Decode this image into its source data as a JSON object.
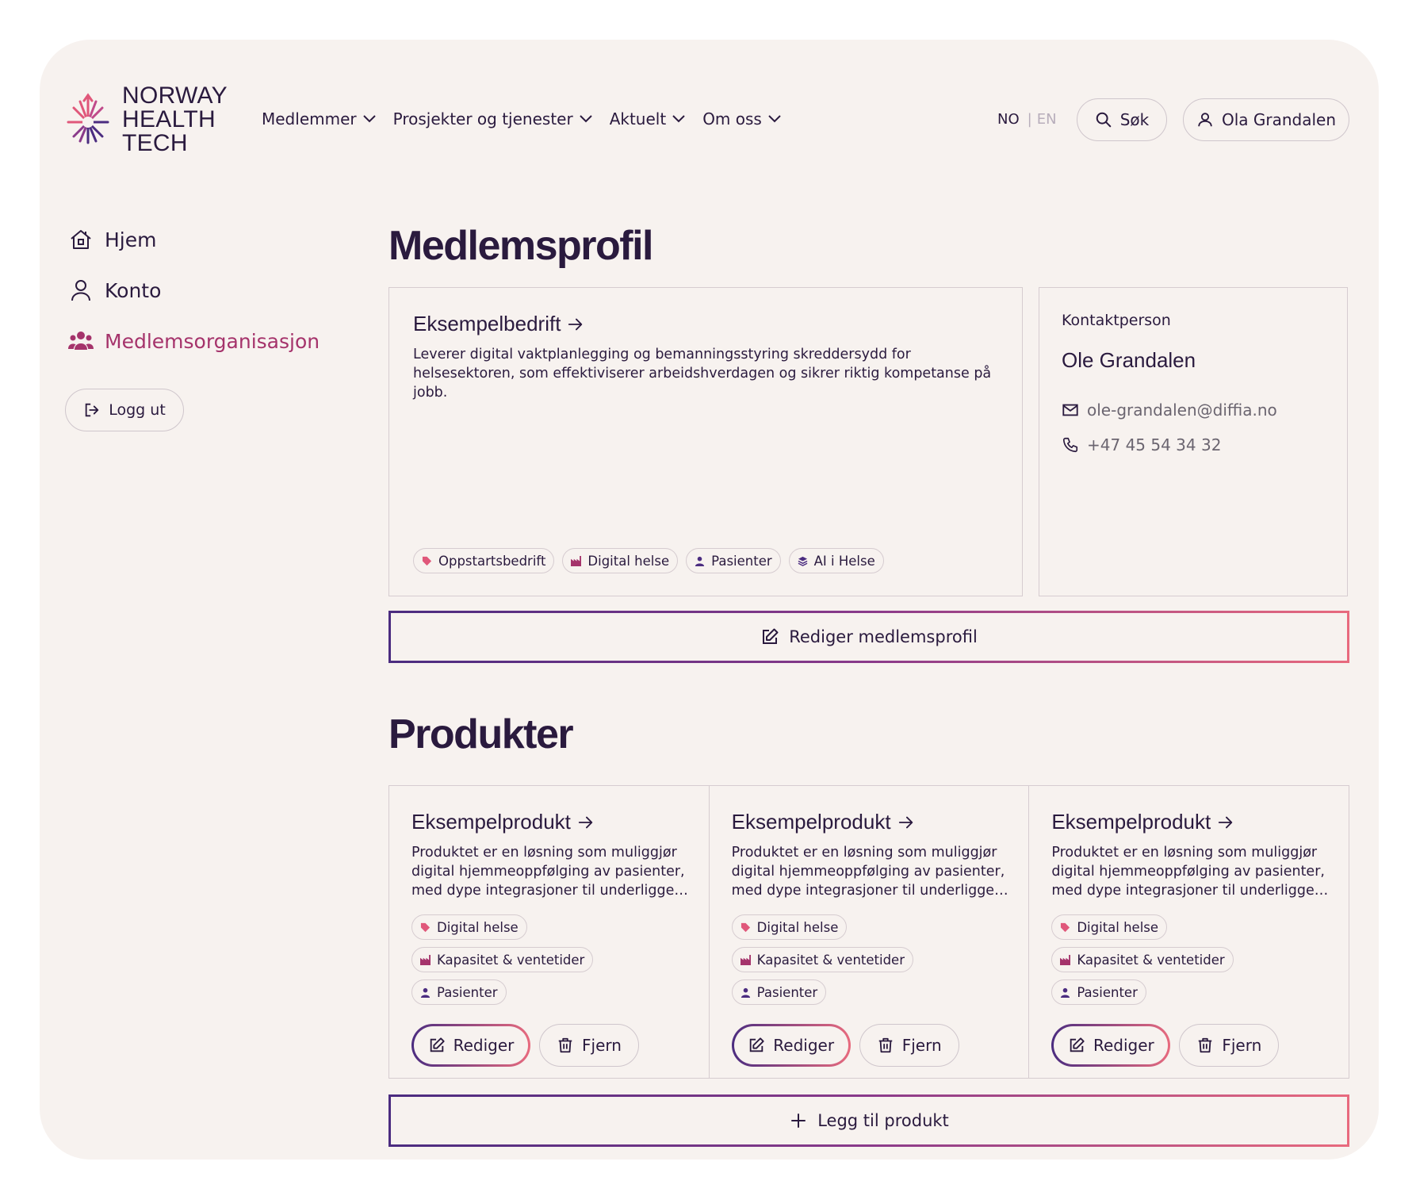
{
  "brand": {
    "logo_lines": [
      "NORWAY",
      "HEALTH",
      "TECH"
    ],
    "colors": {
      "accent": "#a5336b",
      "ink": "#2a1a3e",
      "gradient_start": "#4b2c80",
      "gradient_end": "#e86a7e",
      "bg": "#f7f2ef"
    }
  },
  "nav": {
    "items": [
      {
        "label": "Medlemmer"
      },
      {
        "label": "Prosjekter og tjenester"
      },
      {
        "label": "Aktuelt"
      },
      {
        "label": "Om oss"
      }
    ],
    "lang": {
      "no": "NO",
      "sep": "|",
      "en": "EN"
    },
    "search_label": "Søk",
    "user_label": "Ola Grandalen"
  },
  "sidebar": {
    "items": [
      {
        "label": "Hjem",
        "icon": "home-icon"
      },
      {
        "label": "Konto",
        "icon": "user-icon"
      },
      {
        "label": "Medlemsorganisasjon",
        "icon": "users-icon",
        "active": true
      }
    ],
    "logout_label": "Logg ut"
  },
  "profile": {
    "heading": "Medlemsprofil",
    "company": {
      "name": "Eksempelbedrift",
      "description": "Leverer digital vaktplanlegging og bemanningsstyring skreddersydd for helsesektoren, som effektiviserer arbeidshverdagen og sikrer riktig kompetanse på jobb.",
      "tags": [
        "Oppstartsbedrift",
        "Digital helse",
        "Pasienter",
        "AI i Helse"
      ]
    },
    "contact": {
      "label": "Kontaktperson",
      "name": "Ole Grandalen",
      "email": "ole-grandalen@diffia.no",
      "phone": "+47 45 54 34 32"
    },
    "edit_label": "Rediger medlemsprofil"
  },
  "products": {
    "heading": "Produkter",
    "items": [
      {
        "name": "Eksempelprodukt",
        "description": "Produktet er en løsning som muliggjør digital hjemmeoppfølging av pasienter, med dype integrasjoner til underligge…",
        "tags": [
          "Digital helse",
          "Kapasitet & ventetider",
          "Pasienter"
        ],
        "edit_label": "Rediger",
        "remove_label": "Fjern"
      },
      {
        "name": "Eksempelprodukt",
        "description": "Produktet er en løsning som muliggjør digital hjemmeoppfølging av pasienter, med dype integrasjoner til underligge…",
        "tags": [
          "Digital helse",
          "Kapasitet & ventetider",
          "Pasienter"
        ],
        "edit_label": "Rediger",
        "remove_label": "Fjern"
      },
      {
        "name": "Eksempelprodukt",
        "description": "Produktet er en løsning som muliggjør digital hjemmeoppfølging av pasienter, med dype integrasjoner til underligge…",
        "tags": [
          "Digital helse",
          "Kapasitet & ventetider",
          "Pasienter"
        ],
        "edit_label": "Rediger",
        "remove_label": "Fjern"
      }
    ],
    "add_label": "Legg til produkt"
  }
}
